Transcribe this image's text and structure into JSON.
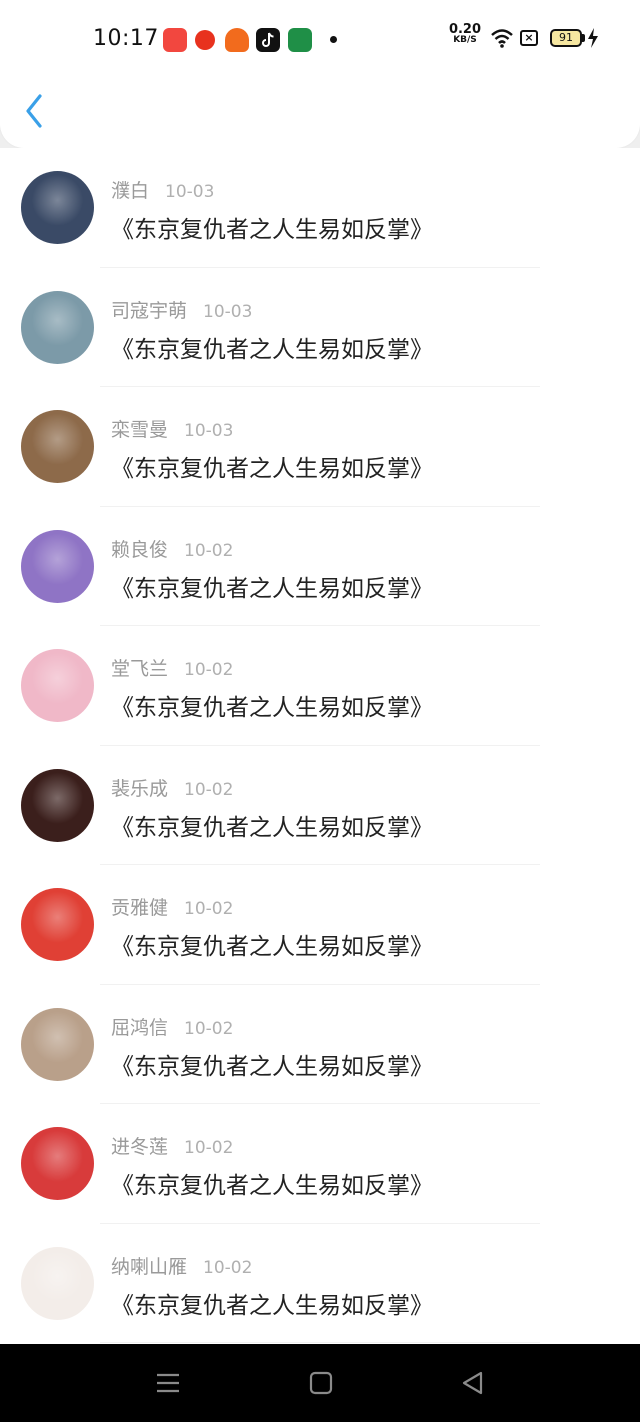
{
  "status_bar": {
    "time": "10:17",
    "net_speed_value": "0.20",
    "net_speed_unit": "KB/S",
    "battery_level": "91",
    "icons": [
      "app-icon-1",
      "app-icon-2",
      "app-icon-3",
      "tiktok-icon",
      "app-icon-5",
      "notification-dot",
      "wifi-icon",
      "sim-icon",
      "battery-icon",
      "charging-icon"
    ]
  },
  "header": {
    "back_icon": "chevron-left-icon"
  },
  "comment_content": "《东京复仇者之人生易如反掌》",
  "items": [
    {
      "name": "濮白",
      "date": "10-03",
      "avatar_color": "#3a4a66"
    },
    {
      "name": "司寇宇萌",
      "date": "10-03",
      "avatar_color": "#7c9aa8"
    },
    {
      "name": "栾雪曼",
      "date": "10-03",
      "avatar_color": "#8d6a4a"
    },
    {
      "name": "赖良俊",
      "date": "10-02",
      "avatar_color": "#8f74c5"
    },
    {
      "name": "堂飞兰",
      "date": "10-02",
      "avatar_color": "#f0b8c8"
    },
    {
      "name": "裴乐成",
      "date": "10-02",
      "avatar_color": "#3b1f1c"
    },
    {
      "name": "贡雅健",
      "date": "10-02",
      "avatar_color": "#e04035"
    },
    {
      "name": "屈鸿信",
      "date": "10-02",
      "avatar_color": "#b9a08a"
    },
    {
      "name": "进冬莲",
      "date": "10-02",
      "avatar_color": "#d83b3b"
    },
    {
      "name": "纳喇山雁",
      "date": "10-02",
      "avatar_color": "#f3ede9"
    }
  ],
  "nav_bar": {
    "buttons": [
      "menu-icon",
      "home-icon",
      "back-triangle-icon"
    ]
  },
  "colors": {
    "accent": "#3aa0e8",
    "name_text": "#9a9a9a",
    "content_text": "#222222"
  }
}
